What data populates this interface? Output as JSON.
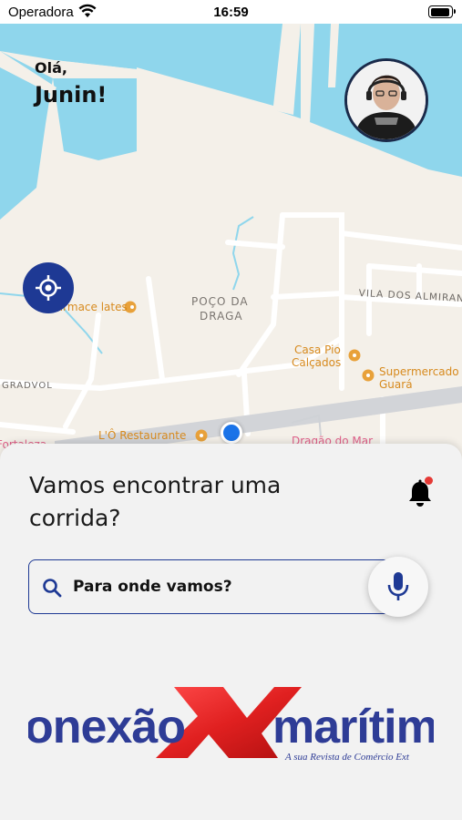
{
  "status_bar": {
    "carrier": "Operadora",
    "time": "16:59"
  },
  "greeting": {
    "small": "Olá,",
    "name": "Junin!"
  },
  "map": {
    "labels": {
      "poco_line1": "POÇO DA",
      "poco_line2": "DRAGA",
      "vila": "VILA DOS ALMIRANTES",
      "gradvol": "GRADVOL",
      "farmace": "Farmace lates",
      "casa_pio_1": "Casa Pio",
      "casa_pio_2": "Calçados",
      "supermercado_1": "Supermercado",
      "supermercado_2": "Guará",
      "restaurante": "L'Ô Restaurante",
      "dragao": "Dragão do Mar",
      "fortaleza": "Fortaleza"
    }
  },
  "sheet": {
    "title": "Vamos encontrar uma corrida?",
    "search_placeholder": "Para onde vamos?"
  },
  "logo": {
    "left_word": "onexão",
    "right_word": "marítim",
    "tagline": "A sua Revista de Comércio Ext"
  },
  "colors": {
    "accent": "#1e3994",
    "water": "#8fd6ec",
    "map_land": "#f4f0e9",
    "poi_orange": "#e8a13a",
    "poi_pink": "#e0608a",
    "badge_red": "#e53935",
    "logo_blue": "#2e3c96",
    "logo_red": "#e02020"
  },
  "icons": {
    "wifi": "wifi-icon",
    "battery": "battery-icon",
    "locate": "crosshair-icon",
    "bell": "bell-icon",
    "search": "search-icon",
    "mic": "microphone-icon"
  }
}
